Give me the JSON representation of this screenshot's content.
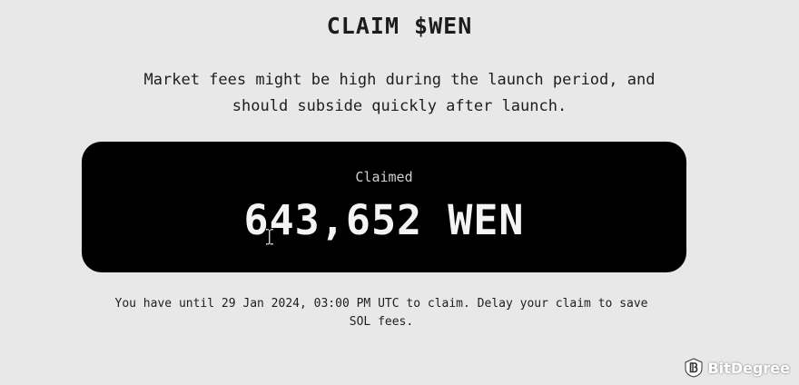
{
  "title": "CLAIM $WEN",
  "notice": {
    "line1": "Market fees might be high during the launch period, and",
    "line2": "should subside quickly after launch."
  },
  "claim_card": {
    "label": "Claimed",
    "amount": "643,652 WEN"
  },
  "deadline": {
    "line1": "You have until 29 Jan 2024, 03:00 PM UTC to claim. Delay your claim to save",
    "line2": "SOL fees."
  },
  "watermark": {
    "text": "BitDegree",
    "icon": "bitdegree-logo-icon"
  },
  "colors": {
    "background": "#e8e8e8",
    "card": "#000000",
    "card_text": "#f4f4f4"
  }
}
